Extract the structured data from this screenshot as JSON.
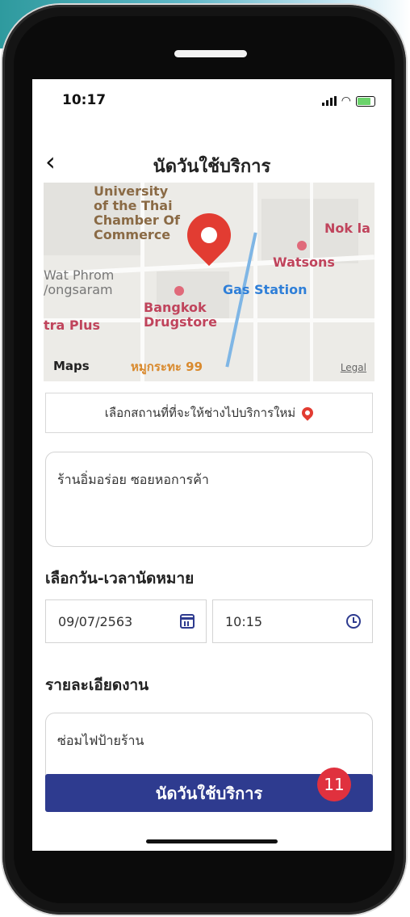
{
  "status_bar": {
    "time": "10:17"
  },
  "header": {
    "title": "นัดวันใช้บริการ",
    "back_icon": "chevron-left-icon"
  },
  "map": {
    "labels": {
      "university": "University\nof the Thai\nChamber Of\nCommerce",
      "nok": "Nok la",
      "watsons": "Watsons",
      "wat": "Wat Phrom\n/ongsaram",
      "gas": "Gas Station",
      "bangkok": "Bangkok\nDrugstore",
      "tra": "tra Plus",
      "route": "หมูกระทะ 99"
    },
    "maps_brand": "Maps",
    "legal": "Legal"
  },
  "location_button": {
    "label": "เลือกสถานที่ที่จะให้ช่างไปบริการใหม่",
    "icon": "map-pin-icon"
  },
  "address": {
    "value": "ร้านอิ่มอร่อย ซอยหอการค้า"
  },
  "datetime": {
    "label": "เลือกวัน-เวลานัดหมาย",
    "date": "09/07/2563",
    "time": "10:15"
  },
  "details": {
    "label": "รายละเอียดงาน",
    "value": "ซ่อมไฟป้ายร้าน"
  },
  "submit": {
    "label": "นัดวันใช้บริการ"
  },
  "step_badge": "11",
  "colors": {
    "primary": "#2e3b8f",
    "pin": "#e23c32",
    "badge": "#e0313e"
  }
}
